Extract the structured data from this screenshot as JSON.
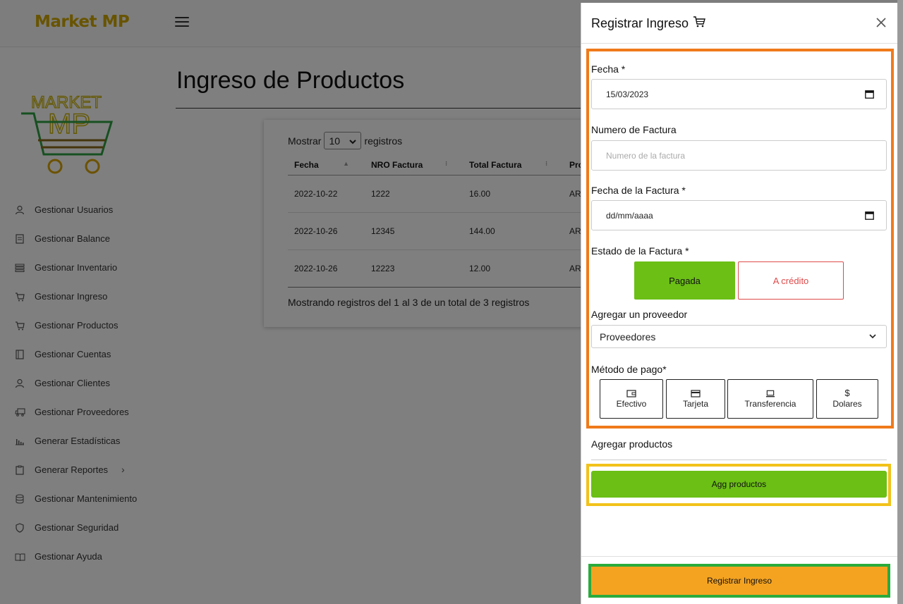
{
  "app": {
    "brand": "Market MP"
  },
  "sidebar": {
    "logo": {
      "line1": "MARKET",
      "line2": "MP"
    },
    "items": [
      {
        "label": "Gestionar Usuarios",
        "icon": "user-icon"
      },
      {
        "label": "Gestionar Balance",
        "icon": "receipt-icon"
      },
      {
        "label": "Gestionar Inventario",
        "icon": "list-icon"
      },
      {
        "label": "Gestionar Ingreso",
        "icon": "cart-icon"
      },
      {
        "label": "Gestionar Productos",
        "icon": "cart-icon"
      },
      {
        "label": "Gestionar Cuentas",
        "icon": "book-icon"
      },
      {
        "label": "Gestionar Clientes",
        "icon": "user-icon"
      },
      {
        "label": "Gestionar Proveedores",
        "icon": "truck-icon"
      },
      {
        "label": "Generar Estadísticas",
        "icon": "chart-icon"
      },
      {
        "label": "Generar Reportes",
        "icon": "clipboard-icon"
      },
      {
        "label": "Gestionar Mantenimiento",
        "icon": "database-icon"
      },
      {
        "label": "Gestionar Seguridad",
        "icon": "shield-icon"
      },
      {
        "label": "Gestionar Ayuda",
        "icon": "open-book-icon"
      }
    ]
  },
  "main": {
    "title": "Ingreso de Productos",
    "table": {
      "show_prefix": "Mostrar",
      "page_size": "10",
      "show_suffix": "registros",
      "columns": [
        "Fecha",
        "NRO Factura",
        "Total Factura",
        "Pro"
      ],
      "rows": [
        [
          "2022-10-22",
          "1222",
          "16.00",
          "AR"
        ],
        [
          "2022-10-26",
          "12345",
          "144.00",
          "AR"
        ],
        [
          "2022-10-26",
          "12223",
          "12.00",
          "AR"
        ]
      ],
      "info": "Mostrando registros del 1 al 3 de un total de 3 registros"
    }
  },
  "panel": {
    "title": "Registrar Ingreso",
    "fecha": {
      "label": "Fecha *",
      "value": "15/03/2023"
    },
    "numero_factura": {
      "label": "Numero de Factura",
      "placeholder": "Numero de la factura"
    },
    "fecha_factura": {
      "label": "Fecha de la Factura *",
      "value": "dd/mm/aaaa"
    },
    "estado": {
      "label": "Estado de la Factura *",
      "pagada": "Pagada",
      "credito": "A crédito"
    },
    "proveedor": {
      "label": "Agregar un proveedor",
      "selected": "Proveedores"
    },
    "metodo_pago": {
      "label": "Método de pago*",
      "options": [
        {
          "label": "Efectivo",
          "icon": "wallet-icon"
        },
        {
          "label": "Tarjeta",
          "icon": "credit-card-icon"
        },
        {
          "label": "Transferencia",
          "icon": "laptop-icon"
        },
        {
          "label": "Dolares",
          "icon": "dollar-icon"
        }
      ]
    },
    "productos": {
      "label": "Agregar productos",
      "button": "Agg productos"
    },
    "submit": "Registrar Ingreso"
  },
  "colors": {
    "brand": "#d1a800",
    "green": "#6bbf15",
    "orange_button": "#f4a321",
    "danger": "#e04a4a",
    "highlight_orange": "#f07a1a",
    "highlight_yellow": "#f2c21a",
    "highlight_green": "#2bab3c"
  }
}
